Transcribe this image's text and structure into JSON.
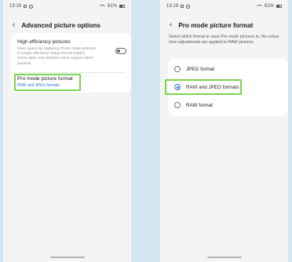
{
  "status_bar": {
    "time": "13:19",
    "battery": "61%"
  },
  "left_screen": {
    "title": "Advanced picture options",
    "items": [
      {
        "title": "High efficiency pictures",
        "description": "Save space by capturing Photo mode pictures in a high efficiency image format (HEIF). Some apps and websites don't support HEIF pictures.",
        "toggle_on": false
      },
      {
        "title": "Pro mode picture format",
        "subtitle": "RAW and JPEG formats"
      }
    ]
  },
  "right_screen": {
    "title": "Pro mode picture format",
    "description": "Select which format to save Pro mode pictures in. No colour tone adjustments are applied to RAW pictures.",
    "options": [
      {
        "label": "JPEG format",
        "selected": false
      },
      {
        "label": "RAW and JPEG formats",
        "selected": true
      },
      {
        "label": "RAW format",
        "selected": false
      }
    ]
  },
  "colors": {
    "accent": "#2f6ee0",
    "highlight": "#7ad44f",
    "background": "#d3e7f3"
  }
}
